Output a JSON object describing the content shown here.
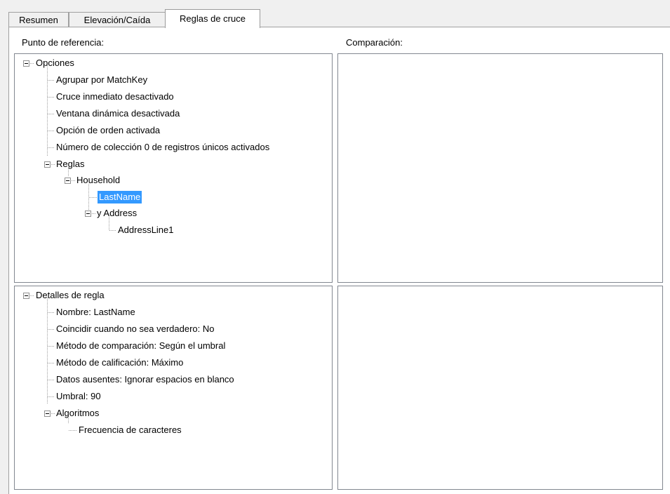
{
  "tabs": [
    {
      "label": "Resumen",
      "active": false
    },
    {
      "label": "Elevación/Caída",
      "active": false
    },
    {
      "label": "Reglas de cruce",
      "active": true
    }
  ],
  "labels": {
    "reference": "Punto de referencia:",
    "comparison": "Comparación:"
  },
  "reference_tree": {
    "root": "Opciones",
    "options": [
      "Agrupar por MatchKey",
      "Cruce inmediato desactivado",
      "Ventana dinámica desactivada",
      "Opción de orden activada",
      "Número de colección 0 de registros únicos activados"
    ],
    "rules_label": "Reglas",
    "household": "Household",
    "lastname": "LastName",
    "address": "y Address",
    "addressline": "AddressLine1"
  },
  "details_tree": {
    "root": "Detalles de regla",
    "items": [
      "Nombre: LastName",
      "Coincidir cuando no sea verdadero: No",
      "Método de comparación: Según el umbral",
      "Método de calificación: Máximo",
      "Datos ausentes: Ignorar espacios en blanco",
      "Umbral: 90"
    ],
    "algorithms_label": "Algoritmos",
    "algorithm": "Frecuencia de caracteres"
  },
  "colors": {
    "selection": "#3399ff",
    "pane_border": "#828790"
  }
}
